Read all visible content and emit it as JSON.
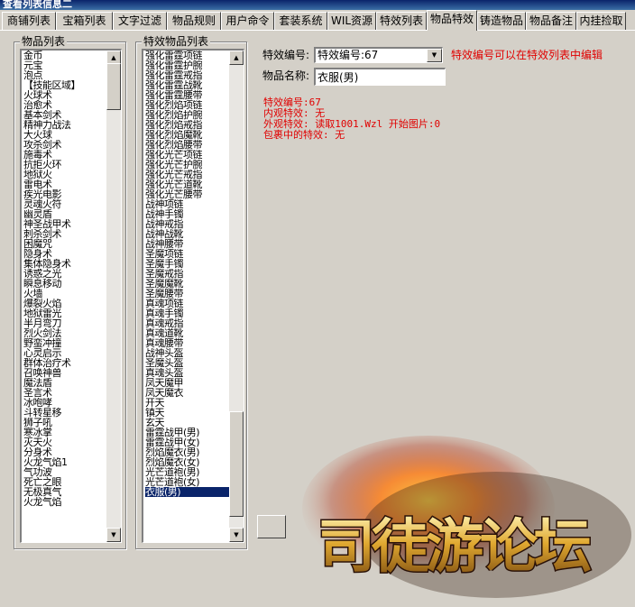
{
  "window": {
    "title": "查看列表信息二"
  },
  "tabs": [
    "商铺列表",
    "宝箱列表",
    "文字过滤",
    "物品规则",
    "用户命令",
    "套装系统",
    "WIL资源",
    "特效列表",
    "物品特效",
    "铸造物品",
    "物品备注",
    "内挂捡取"
  ],
  "active_tab": "物品特效",
  "item_list": {
    "label": "物品列表",
    "items": [
      "金币",
      "元宝",
      "泡点",
      "【技能区域】",
      "火球术",
      "治愈术",
      "基本剑术",
      "精神力战法",
      "大火球",
      "攻杀剑术",
      "施毒术",
      "抗拒火环",
      "地狱火",
      "雷电术",
      "疾光电影",
      "灵魂火符",
      "幽灵盾",
      "神圣战甲术",
      "刺杀剑术",
      "困魔咒",
      "隐身术",
      "集体隐身术",
      "诱惑之光",
      "瞬息移动",
      "火墙",
      "爆裂火焰",
      "地狱雷光",
      "半月弯刀",
      "烈火剑法",
      "野蛮冲撞",
      "心灵启示",
      "群体治疗术",
      "召唤神兽",
      "魔法盾",
      "圣言术",
      "冰咆哮",
      "斗转星移",
      "狮子吼",
      "寒冰掌",
      "灭天火",
      "分身术",
      "火龙气焰1",
      "气功波",
      "死亡之眼",
      "无极真气",
      "火龙气焰"
    ]
  },
  "effect_list": {
    "label": "特效物品列表",
    "items": [
      "强化雷霆项链",
      "强化雷霆护腕",
      "强化雷霆戒指",
      "强化雷霆战靴",
      "强化雷霆腰带",
      "强化烈焰项链",
      "强化烈焰护腕",
      "强化烈焰戒指",
      "强化烈焰魔靴",
      "强化烈焰腰带",
      "强化光芒项链",
      "强化光芒护腕",
      "强化光芒戒指",
      "强化光芒道靴",
      "强化光芒腰带",
      "战神项链",
      "战神手镯",
      "战神戒指",
      "战神战靴",
      "战神腰带",
      "圣魔项链",
      "圣魔手镯",
      "圣魔戒指",
      "圣魔魔靴",
      "圣魔腰带",
      "真魂项链",
      "真魂手镯",
      "真魂戒指",
      "真魂道靴",
      "真魂腰带",
      "战神头盔",
      "圣魔头盔",
      "真魂头盔",
      "凤天魔甲",
      "凤天魔衣",
      "开天",
      "镇天",
      "玄天",
      "雷霆战甲(男)",
      "雷霆战甲(女)",
      "烈焰魔衣(男)",
      "烈焰魔衣(女)",
      "光芒道袍(男)",
      "光芒道袍(女)",
      "衣服(男)"
    ],
    "selected": "衣服(男)"
  },
  "form": {
    "effect_no_label": "特效编号:",
    "effect_no_value": "特效编号:67",
    "effect_hint": "特效编号可以在特效列表中编辑",
    "item_name_label": "物品名称:",
    "item_name_value": "衣服(男)"
  },
  "info_lines": [
    "特效编号:67",
    "内观特效: 无",
    "外观特效: 读取1001.Wzl 开始图片:0",
    "包裹中的特效: 无"
  ],
  "watermark": {
    "text": "司徒游论坛"
  },
  "colors": {
    "accent_red": "#e00000",
    "selection": "#0a246a",
    "window_bg": "#d4d0c8"
  }
}
